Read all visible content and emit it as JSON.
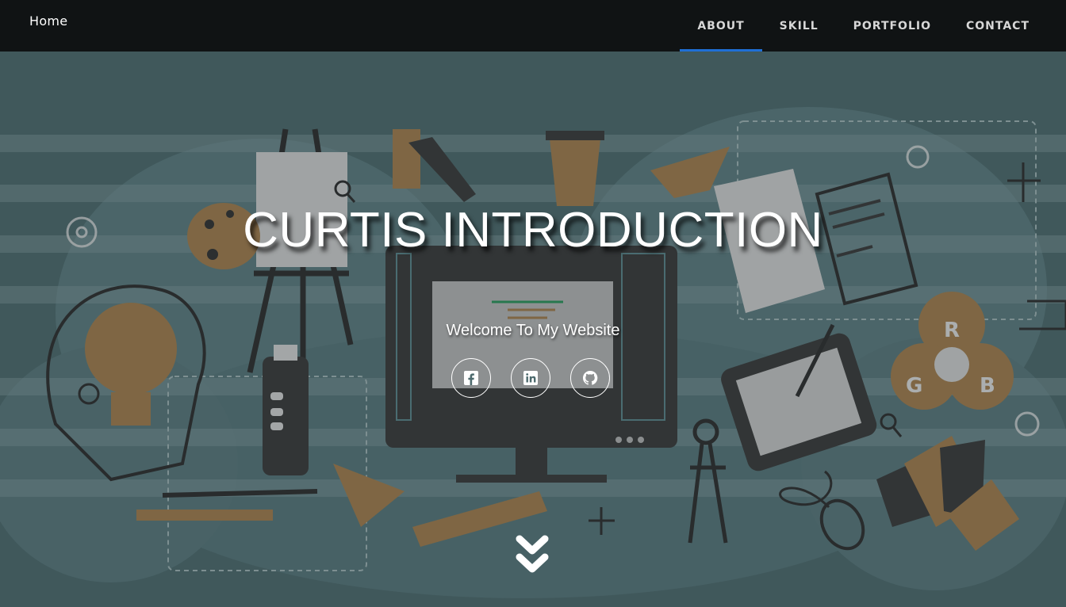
{
  "nav": {
    "brand": "Home",
    "items": [
      {
        "label": "ABOUT",
        "active": true
      },
      {
        "label": "SKILL",
        "active": false
      },
      {
        "label": "PORTFOLIO",
        "active": false
      },
      {
        "label": "CONTACT",
        "active": false
      }
    ],
    "active_color": "#1f6fd6"
  },
  "hero": {
    "title": "CURTIS INTRODUCTION",
    "subtitle": "Welcome To My Website",
    "background_theme": "graphic-design-tools-illustration",
    "socials": [
      {
        "icon": "facebook-icon"
      },
      {
        "icon": "linkedin-icon"
      },
      {
        "icon": "github-icon"
      }
    ],
    "scroll_icon": "double-chevron-down-icon"
  },
  "colors": {
    "navbar_bg": "#101314",
    "hero_teal": "#5d7e82",
    "accent_tan": "#a9824f",
    "dark_gray": "#3b3b3b"
  }
}
